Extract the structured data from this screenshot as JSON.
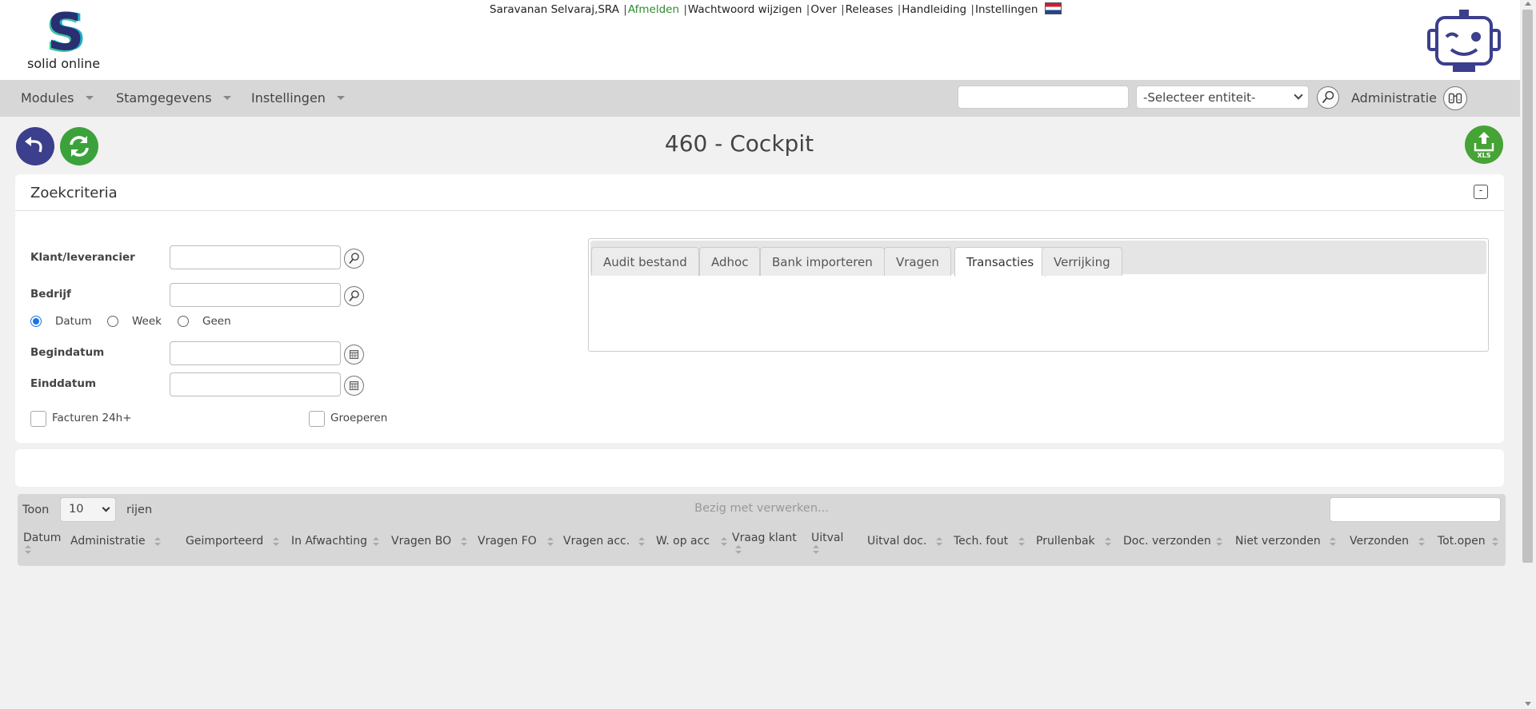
{
  "brand": {
    "logo_letter": "S",
    "name": "solid online"
  },
  "toplinks": {
    "user": "Saravanan Selvaraj,SRA",
    "logout": "Afmelden",
    "change_password": "Wachtwoord wijzigen",
    "about": "Over",
    "releases": "Releases",
    "manual": "Handleiding",
    "settings": "Instellingen",
    "separator": "|"
  },
  "nav": {
    "modules": "Modules",
    "master_data": "Stamgegevens",
    "settings": "Instellingen",
    "search_placeholder": "",
    "entity_select": "-Selecteer entiteit-",
    "administration": "Administratie"
  },
  "page": {
    "title": "460 - Cockpit"
  },
  "criteria": {
    "title": "Zoekcriteria",
    "collapse": "-",
    "customer_supplier": "Klant/leverancier",
    "company": "Bedrijf",
    "radio_options": [
      {
        "label": "Datum",
        "checked": true
      },
      {
        "label": "Week",
        "checked": false
      },
      {
        "label": "Geen",
        "checked": false
      }
    ],
    "start_date": "Begindatum",
    "end_date": "Einddatum",
    "invoices_24h": "Facturen 24h+",
    "group": "Groeperen",
    "tabs": [
      {
        "label": "Audit bestand",
        "active": false
      },
      {
        "label": "Adhoc",
        "active": false
      },
      {
        "label": "Bank importeren",
        "active": false
      },
      {
        "label": "Vragen",
        "active": false
      },
      {
        "label": "Transacties",
        "active": true
      },
      {
        "label": "Verrijking",
        "active": false
      }
    ]
  },
  "grid": {
    "show": "Toon",
    "page_length": "10",
    "rows": "rijen",
    "processing": "Bezig met verwerken...",
    "columns": [
      "Datum",
      "Administratie",
      "Geimporteerd",
      "In Afwachting",
      "Vragen BO",
      "Vragen FO",
      "Vragen acc.",
      "W. op acc",
      "Vraag klant",
      "Uitval",
      "Uitval  doc.",
      "Tech. fout",
      "Prullenbak",
      "Doc. verzonden",
      "Niet verzonden",
      "Verzonden",
      "Tot.open"
    ]
  },
  "icons": {
    "back": "undo-arrow-icon",
    "refresh": "refresh-icon",
    "export": "xls-export-icon",
    "lookup": "magnifier-icon",
    "calendar": "calendar-icon",
    "binoculars": "binoculars-icon",
    "robot": "robot-icon",
    "flag": "netherlands-flag-icon"
  },
  "colors": {
    "link_green": "#2e8b2e",
    "back_button": "#3b3f8c",
    "refresh_button": "#3ba23b",
    "export_button": "#46a336",
    "navbar": "#d7d7d7"
  }
}
